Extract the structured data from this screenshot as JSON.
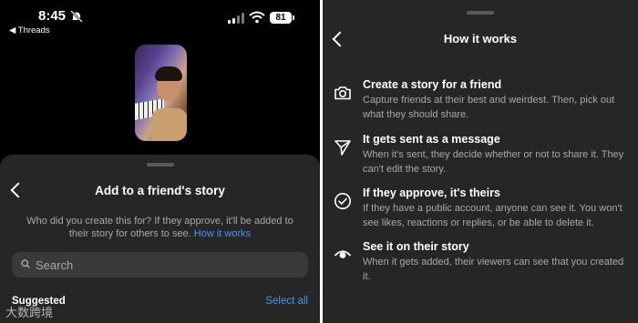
{
  "status_bar": {
    "time": "8:45",
    "back_label": "◀ Threads",
    "battery": "81"
  },
  "sheet": {
    "title": "Add to a friend's story",
    "description": "Who did you create this for? If they approve, it'll be added to their story for others to see.",
    "link": "How it works",
    "search": {
      "placeholder": "Search",
      "value": ""
    },
    "suggested_label": "Suggested",
    "select_all_label": "Select all"
  },
  "watermark": "大数跨境",
  "how_it_works": {
    "title": "How it works",
    "items": [
      {
        "icon": "camera-icon",
        "title": "Create a story for a friend",
        "desc": "Capture friends at their best and weirdest. Then, pick out what they should share."
      },
      {
        "icon": "send-icon",
        "title": "It gets sent as a message",
        "desc": "When it's sent, they decide whether or not to share it. They can't edit the story."
      },
      {
        "icon": "check-circle-icon",
        "title": "If they approve, it's theirs",
        "desc": "If they have a public account, anyone can see it. You won't see likes, reactions or replies, or be able to delete it."
      },
      {
        "icon": "eye-icon",
        "title": "See it on their story",
        "desc": "When it gets added, their viewers can see that you created it."
      }
    ]
  },
  "colors": {
    "accent": "#4b93f5",
    "sheet_bg": "#262626",
    "muted_text": "#a8a8a8"
  }
}
